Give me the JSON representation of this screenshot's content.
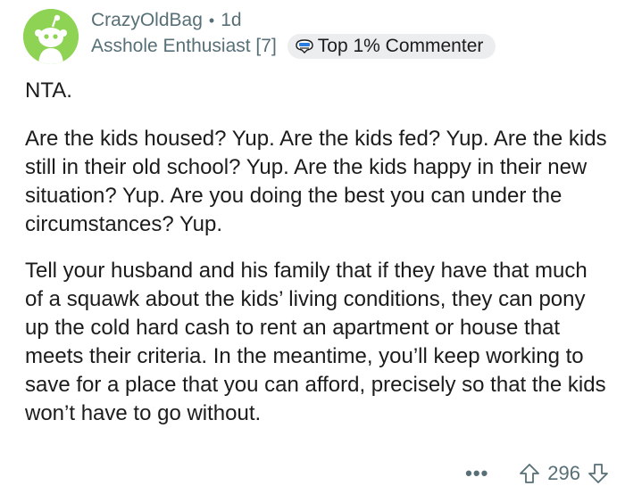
{
  "comment": {
    "author": "CrazyOldBag",
    "separator": "•",
    "age": "1d",
    "flair": "Asshole Enthusiast [7]",
    "badge_label": "Top 1% Commenter",
    "paragraphs": [
      "NTA.",
      "Are the kids housed? Yup. Are the kids fed? Yup. Are the kids still in their old school? Yup. Are the kids happy in their new situation? Yup. Are you doing the best you can under the circumstances? Yup.",
      "Tell your husband and his family that if they have that much of a squawk about the kids’ living conditions, they can pony up the cold hard cash to rent an apartment or house that meets their criteria. In the meantime, you’ll keep working to save for a place that you can afford, precisely so that the kids won’t have to go without."
    ]
  },
  "actions": {
    "more_label": "•••",
    "score": "296"
  },
  "icons": {
    "avatar": "snoo-avatar",
    "badge": "top-commenter-icon",
    "upvote": "upvote-arrow-icon",
    "downvote": "downvote-arrow-icon",
    "more": "overflow-menu-icon"
  },
  "colors": {
    "avatar_bg": "#8ed354",
    "meta_text": "#576f76",
    "badge_bg": "#ebedef",
    "body_text": "#1c1c1c"
  }
}
